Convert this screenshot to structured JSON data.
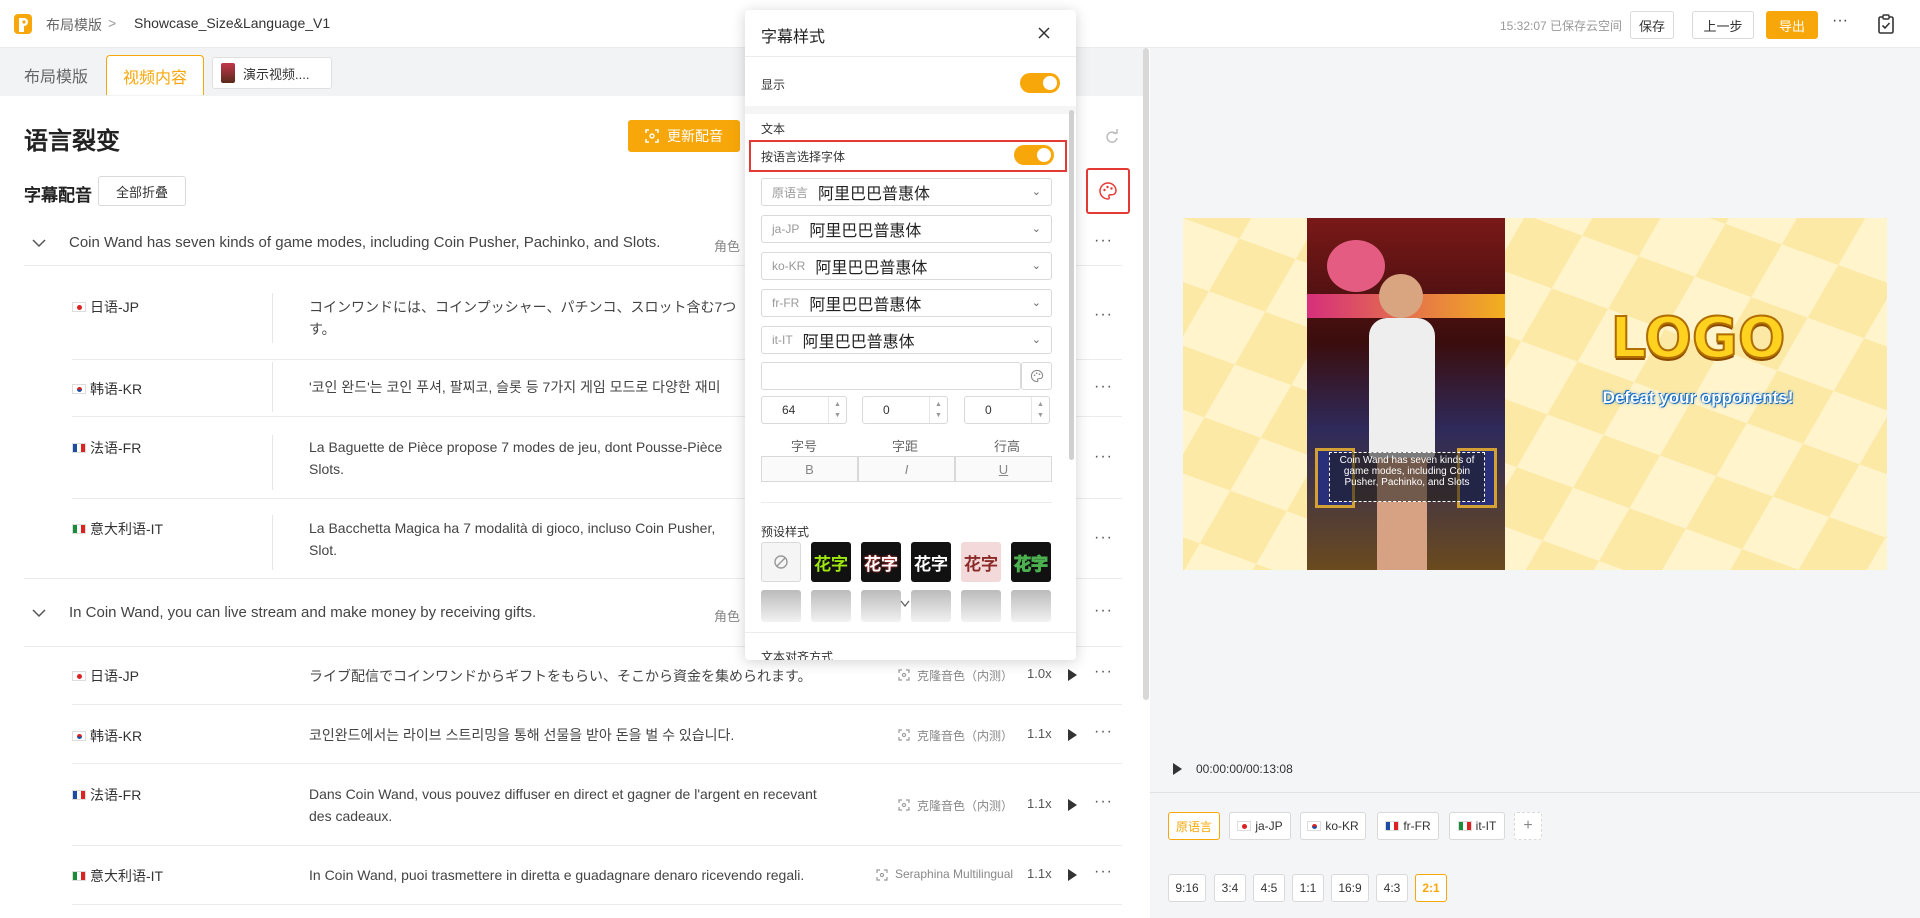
{
  "header": {
    "breadcrumb_root": "布局模版",
    "breadcrumb_sep": ">",
    "project_name": "Showcase_Size&Language_V1",
    "save_status": "15:32:07 已保存云空间",
    "save_label": "保存",
    "prev_label": "上一步",
    "export_label": "导出",
    "more_label": "···"
  },
  "tabs": {
    "layout": "布局模版",
    "video": "视频内容",
    "file": "演示视频...."
  },
  "main": {
    "title": "语言裂变",
    "update_button": "更新配音",
    "subtitle_section": "字幕配音",
    "collapse_all": "全部折叠",
    "role_label": "角色"
  },
  "groups": [
    {
      "source": "Coin Wand has seven kinds of game modes, including Coin Pusher, Pachinko, and Slots.",
      "rows": [
        {
          "lang": "日语-JP",
          "text": "コインワンドには、コインプッシャー、パチンコ、スロット含む7つ",
          "text2": "す。"
        },
        {
          "lang": "韩语-KR",
          "text": "'코인 완드'는 코인 푸셔, 팔찌코, 슬롯 등 7가지 게임 모드로 다양한 재미",
          "text2": ""
        },
        {
          "lang": "法语-FR",
          "text": "La Baguette de Pièce propose 7 modes de jeu, dont Pousse-Pièce",
          "text2": "Slots."
        },
        {
          "lang": "意大利语-IT",
          "text": "La Bacchetta Magica ha 7 modalità di gioco, incluso Coin Pusher,",
          "text2": "Slot."
        }
      ]
    },
    {
      "source": "In Coin Wand, you can live stream and make money by receiving gifts.",
      "rows": [
        {
          "lang": "日语-JP",
          "text": "ライブ配信でコインワンドからギフトをもらい、そこから資金を集められます。",
          "text2": "",
          "voice": "克隆音色（内测）",
          "speed": "1.0x"
        },
        {
          "lang": "韩语-KR",
          "text": "코인완드에서는 라이브 스트리밍을 통해 선물을 받아 돈을 벌 수 있습니다.",
          "text2": "",
          "voice": "克隆音色（内测）",
          "speed": "1.1x"
        },
        {
          "lang": "法语-FR",
          "text": "Dans Coin Wand, vous pouvez diffuser en direct et gagner de l'argent en recevant",
          "text2": "des cadeaux.",
          "voice": "克隆音色（内测）",
          "speed": "1.1x"
        },
        {
          "lang": "意大利语-IT",
          "text": "In Coin Wand, puoi trasmettere in diretta e guadagnare denaro ricevendo regali.",
          "text2": "",
          "voice": "Seraphina Multilingual",
          "speed": "1.1x"
        }
      ]
    }
  ],
  "modal": {
    "title": "字幕样式",
    "display_label": "显示",
    "text_section": "文本",
    "font_by_lang": "按语言选择字体",
    "fonts": [
      {
        "tag": "原语言",
        "value": "阿里巴巴普惠体"
      },
      {
        "tag": "ja-JP",
        "value": "阿里巴巴普惠体"
      },
      {
        "tag": "ko-KR",
        "value": "阿里巴巴普惠体"
      },
      {
        "tag": "fr-FR",
        "value": "阿里巴巴普惠体"
      },
      {
        "tag": "it-IT",
        "value": "阿里巴巴普惠体"
      }
    ],
    "font_size": "64",
    "letter_spacing": "0",
    "line_height": "0",
    "font_size_label": "字号",
    "letter_spacing_label": "字距",
    "line_height_label": "行高",
    "bold": "B",
    "italic": "I",
    "underline": "U",
    "preset_section": "预设样式",
    "preset_text": "花字",
    "align_section": "文本对齐方式"
  },
  "preview": {
    "logo_text": "LOGO",
    "slogan": "Defeat your opponents!",
    "caption": "Coin Wand has seven kinds of game modes, including Coin Pusher, Pachinko, and Slots",
    "time": "00:00:00/00:13:08"
  },
  "languages": [
    "原语言",
    "ja-JP",
    "ko-KR",
    "fr-FR",
    "it-IT"
  ],
  "add_label": "+",
  "ratios": [
    "9:16",
    "3:4",
    "4:5",
    "1:1",
    "16:9",
    "4:3",
    "2:1"
  ],
  "colors": {
    "accent": "#f7a70a",
    "highlight": "#e53935"
  }
}
